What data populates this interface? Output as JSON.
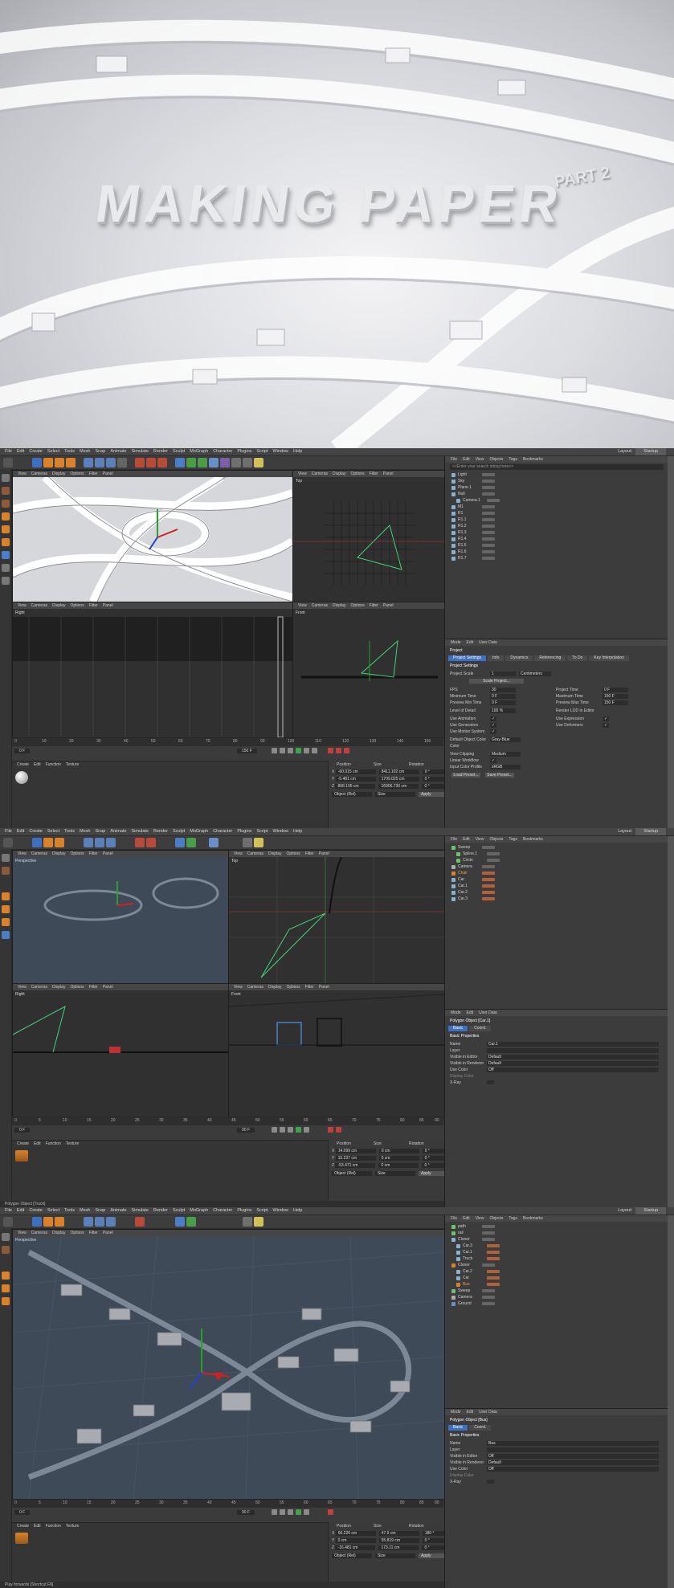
{
  "hero": {
    "title": "MAKING PAPER",
    "subtitle": "PART 2"
  },
  "menu": [
    "File",
    "Edit",
    "Create",
    "Select",
    "Tools",
    "Mesh",
    "Snap",
    "Animate",
    "Simulate",
    "Render",
    "Sculpt",
    "MoGraph",
    "Character",
    "Plugins",
    "Script",
    "Window",
    "Help"
  ],
  "layout_label": "Layout:",
  "layout_value": "Startup",
  "viewport_menu": [
    "View",
    "Cameras",
    "Display",
    "Options",
    "Filter",
    "Panel"
  ],
  "om_menu": [
    "File",
    "Edit",
    "View",
    "Objects",
    "Tags",
    "Bookmarks"
  ],
  "attr_menu": [
    "Mode",
    "Edit",
    "User Data"
  ],
  "mat_menu": [
    "Create",
    "Edit",
    "Function",
    "Texture"
  ],
  "coord_headers": [
    "Position",
    "Size",
    "Rotation"
  ],
  "shot1": {
    "vp_labels": [
      "",
      "Top",
      "Right",
      "Front"
    ],
    "search": "<<Enter your search string here>>",
    "objects": [
      "Light",
      "Sky",
      "Plane.1",
      "Null",
      "Camera.1",
      "M1",
      "R1",
      "R1.1",
      "R1.2",
      "R1.3",
      "R1.4",
      "R1.5",
      "R1.6",
      "R1.7"
    ],
    "attr_title": "Project",
    "tabs": [
      "Project Settings",
      "Info",
      "Dynamics",
      "Referencing",
      "To Do",
      "Key Interpolation"
    ],
    "section": "Project Settings",
    "fields": [
      {
        "label": "Project Scale",
        "value": "1"
      },
      {
        "label": "FPS",
        "value": "30"
      },
      {
        "label": "Minimum Time",
        "value": "0 F"
      },
      {
        "label": "Preview Min Time",
        "value": "0 F"
      },
      {
        "label": "Level of Detail",
        "value": "100 %"
      },
      {
        "label": "Use Animation",
        "value": "✓"
      },
      {
        "label": "Use Generators",
        "value": "✓"
      },
      {
        "label": "Use Motion System",
        "value": "✓"
      },
      {
        "label": "Default Object Color",
        "value": "Gray-Blue"
      },
      {
        "label": "Color",
        "value": ""
      },
      {
        "label": "View Clipping",
        "value": "Medium"
      },
      {
        "label": "Linear Workflow",
        "value": "✓"
      },
      {
        "label": "Input Color Profile",
        "value": "sRGB"
      }
    ],
    "fields_right": [
      {
        "label": "Project Time",
        "value": "0 F"
      },
      {
        "label": "Maximum Time",
        "value": "150 F"
      },
      {
        "label": "Preview Max Time",
        "value": "150 F"
      },
      {
        "label": "Render LOD in Editor",
        "value": ""
      },
      {
        "label": "Use Expression",
        "value": "✓"
      },
      {
        "label": "Use Deformers",
        "value": "✓"
      }
    ],
    "scale_unit": "Centimeters",
    "scale_btn": "Scale Project...",
    "load_btn": "Load Preset...",
    "save_btn": "Save Preset...",
    "ruler": [
      "0",
      "10",
      "20",
      "30",
      "40",
      "50",
      "60",
      "70",
      "80",
      "90",
      "100",
      "110",
      "120",
      "130",
      "140",
      "150"
    ],
    "frame_start": "0 F",
    "frame_end": "150 F",
    "coords": [
      {
        "axis": "X",
        "pos": "-60.015 cm",
        "size": "8411.102 cm",
        "rot": "0 °"
      },
      {
        "axis": "Y",
        "pos": "-5.481 cm",
        "size": "1709.025 cm",
        "rot": "0 °"
      },
      {
        "axis": "Z",
        "pos": "868.195 cm",
        "size": "16906.730 cm",
        "rot": "0 °"
      }
    ],
    "obj_mode": "Object (Rel)",
    "size_mode": "Size",
    "apply": "Apply"
  },
  "shot2": {
    "vp_labels": [
      "Perspective",
      "Top",
      "Right",
      "Front"
    ],
    "objects": [
      "Sweep",
      "Spline.1",
      "Circle",
      "Camera",
      "Chair",
      "Car",
      "Car.1",
      "Car.2",
      "Car.3"
    ],
    "attr_title": "Polygon Object [Car.1]",
    "tabs": [
      "Basic",
      "Coord."
    ],
    "section": "Basic Properties",
    "fields": [
      {
        "label": "Name",
        "value": "Car.1"
      },
      {
        "label": "Layer",
        "value": ""
      },
      {
        "label": "Visible in Editor",
        "value": "Default"
      },
      {
        "label": "Visible in Renderer",
        "value": "Default"
      },
      {
        "label": "Use Color",
        "value": "Off"
      },
      {
        "label": "Display Color",
        "value": ""
      },
      {
        "label": "X-Ray",
        "value": ""
      }
    ],
    "ruler": [
      "0",
      "5",
      "10",
      "15",
      "20",
      "25",
      "30",
      "35",
      "40",
      "45",
      "50",
      "55",
      "60",
      "65",
      "70",
      "75",
      "80",
      "85",
      "90"
    ],
    "frame_start": "0 F",
    "frame_end": "90 F",
    "coords": [
      {
        "axis": "X",
        "pos": "14.099 cm",
        "size": "0 cm",
        "rot": "0 °"
      },
      {
        "axis": "Y",
        "pos": "15.237 cm",
        "size": "0 cm",
        "rot": "0 °"
      },
      {
        "axis": "Z",
        "pos": "-53.471 cm",
        "size": "0 cm",
        "rot": "0 °"
      }
    ],
    "status": "Polygon Object [Truck]"
  },
  "shot3": {
    "vp_labels": [
      "Perspective"
    ],
    "objects": [
      "path",
      "rail",
      "Cloner",
      "Car.3",
      "Car.1",
      "Truck",
      "Cloner",
      "Car.2",
      "Car",
      "Bus",
      "Sweep",
      "Camera",
      "Ground"
    ],
    "attr_title": "Polygon Object [Bus]",
    "tabs": [
      "Basic",
      "Coord."
    ],
    "section": "Basic Properties",
    "fields": [
      {
        "label": "Name",
        "value": "Bus"
      },
      {
        "label": "Layer",
        "value": ""
      },
      {
        "label": "Visible in Editor",
        "value": "Off"
      },
      {
        "label": "Visible in Renderer",
        "value": "Default"
      },
      {
        "label": "Use Color",
        "value": "Off"
      },
      {
        "label": "Display Color",
        "value": ""
      },
      {
        "label": "X-Ray",
        "value": ""
      }
    ],
    "ruler": [
      "0",
      "5",
      "10",
      "15",
      "20",
      "25",
      "30",
      "35",
      "40",
      "45",
      "50",
      "55",
      "60",
      "65",
      "70",
      "75",
      "80",
      "85",
      "90"
    ],
    "frame_start": "0 F",
    "frame_end": "90 F",
    "coords": [
      {
        "axis": "X",
        "pos": "66.226 cm",
        "size": "47.9 cm",
        "rot": "180 °"
      },
      {
        "axis": "Y",
        "pos": "0 cm",
        "size": "55.819 cm",
        "rot": "0 °"
      },
      {
        "axis": "Z",
        "pos": "-16.481 cm",
        "size": "173.11 cm",
        "rot": "0 °"
      }
    ],
    "status": "Play forwards [Shortcut F8]"
  },
  "colors": {
    "accent": "#3f6fbf",
    "orange": "#d9822b",
    "bg": "#3a3a3a"
  }
}
